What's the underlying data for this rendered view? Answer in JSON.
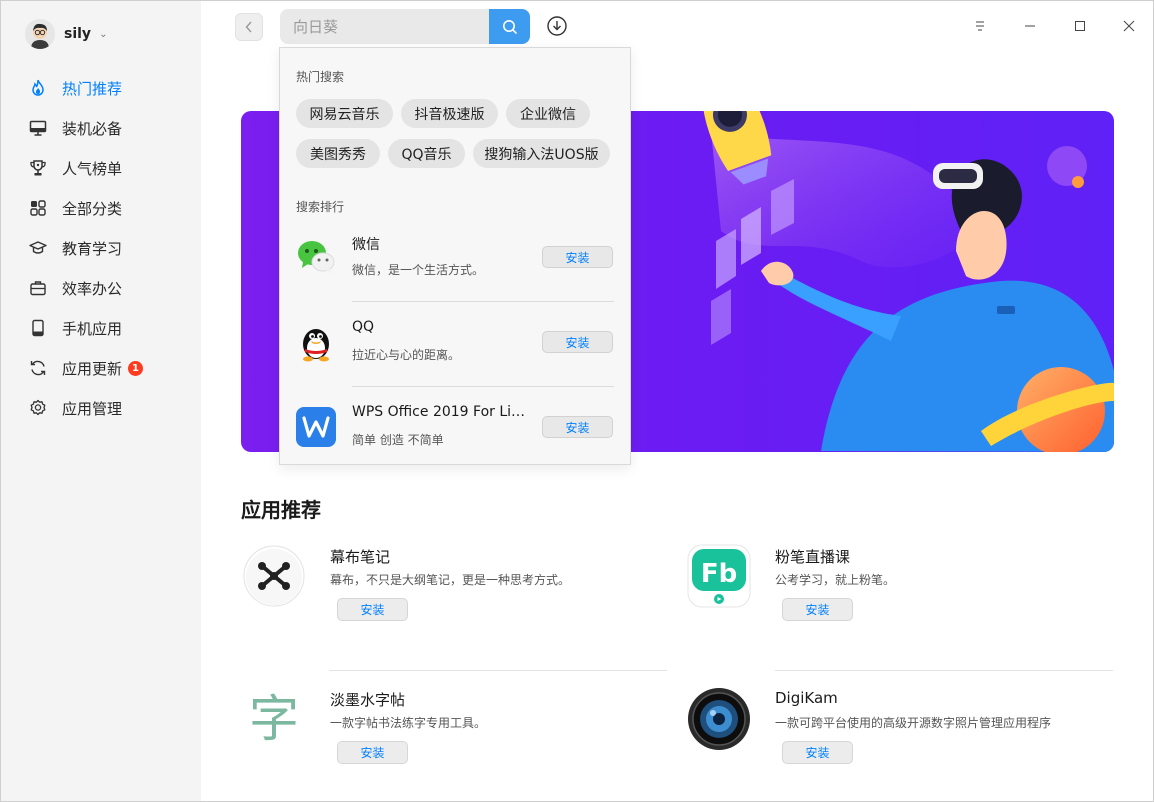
{
  "user": {
    "name": "sily"
  },
  "sidebar": {
    "items": [
      {
        "label": "热门推荐",
        "icon": "flame-icon"
      },
      {
        "label": "装机必备",
        "icon": "monitor-icon"
      },
      {
        "label": "人气榜单",
        "icon": "trophy-icon"
      },
      {
        "label": "全部分类",
        "icon": "grid-icon"
      },
      {
        "label": "教育学习",
        "icon": "graduation-cap-icon"
      },
      {
        "label": "效率办公",
        "icon": "briefcase-icon"
      },
      {
        "label": "手机应用",
        "icon": "phone-icon"
      },
      {
        "label": "应用更新",
        "icon": "refresh-icon",
        "badge": "1"
      },
      {
        "label": "应用管理",
        "icon": "settings-icon"
      }
    ]
  },
  "search": {
    "value": "",
    "placeholder": "向日葵"
  },
  "dropdown": {
    "hot_heading": "热门搜索",
    "hot_chips": [
      "网易云音乐",
      "抖音极速版",
      "企业微信",
      "美图秀秀",
      "QQ音乐",
      "搜狗输入法UOS版"
    ],
    "rank_heading": "搜索排行",
    "rank_items": [
      {
        "name": "微信",
        "desc": "微信，是一个生活方式。",
        "install": "安装",
        "icon": "wechat-icon"
      },
      {
        "name": "QQ",
        "desc": "拉近心与心的距离。",
        "install": "安装",
        "icon": "qq-penguin-icon"
      },
      {
        "name": "WPS Office 2019 For Li…",
        "desc": "简单 创造 不简单",
        "install": "安装",
        "icon": "wps-icon"
      }
    ]
  },
  "main": {
    "section_title": "应用推荐",
    "apps": [
      {
        "name": "幕布笔记",
        "desc": "幕布，不只是大纲笔记，更是一种思考方式。",
        "install": "安装",
        "icon": "mubu-icon"
      },
      {
        "name": "粉笔直播课",
        "desc": "公考学习，就上粉笔。",
        "install": "安装",
        "icon": "fenbi-icon"
      },
      {
        "name": "淡墨水字帖",
        "desc": "一款字帖书法练字专用工具。",
        "install": "安装",
        "icon": "calligraphy-icon",
        "icon_char": "字"
      },
      {
        "name": "DigiKam",
        "desc": "一款可跨平台使用的高级开源数字照片管理应用程序",
        "install": "安装",
        "icon": "camera-lens-icon"
      }
    ]
  },
  "colors": {
    "accent": "#0081ff",
    "banner": "#7b1ef0",
    "badge": "#ff3b1f"
  }
}
